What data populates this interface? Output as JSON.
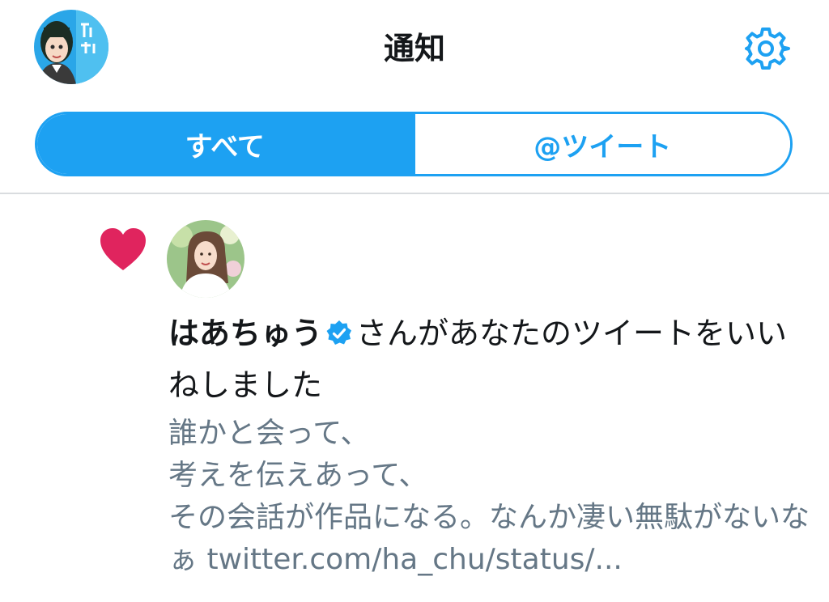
{
  "header": {
    "title": "通知"
  },
  "tabs": [
    {
      "label": "すべて",
      "active": true
    },
    {
      "label": "@ツイート",
      "active": false
    }
  ],
  "notification": {
    "type": "like",
    "user_name": "はあちゅう",
    "verified": true,
    "action_text": "さんがあなたのツイートをいいねしました",
    "tweet_text": "誰かと会って、\n考えを伝えあって、\nその会話が作品になる。なんか凄い無駄がないなぁ ",
    "tweet_link": "twitter.com/ha_chu/status/..."
  },
  "colors": {
    "accent": "#1da1f2",
    "like": "#e0245e",
    "secondary_text": "#657786"
  }
}
